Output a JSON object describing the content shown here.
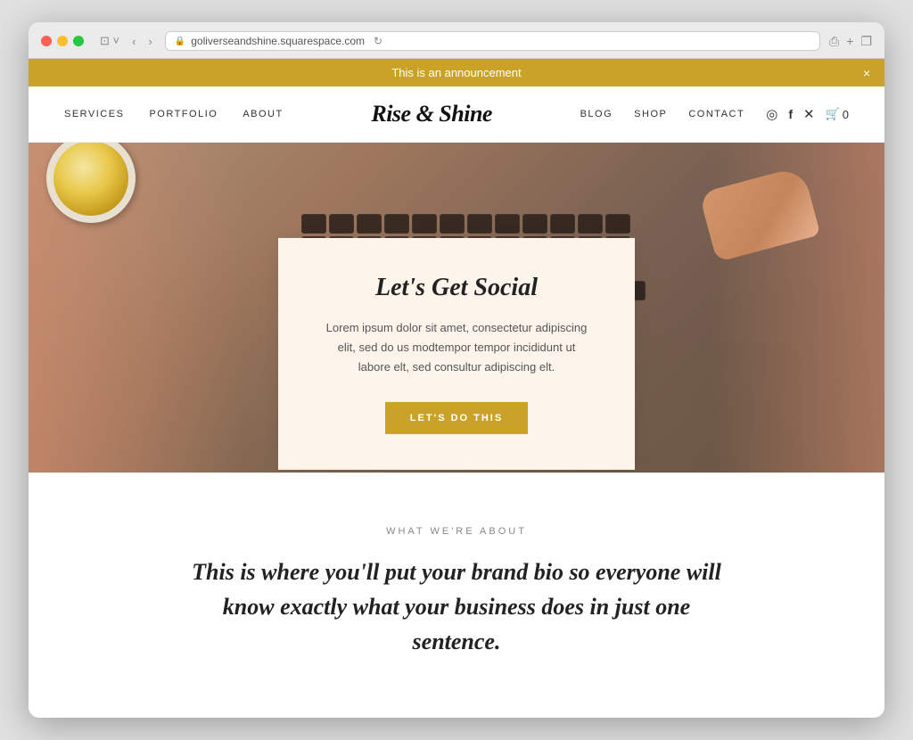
{
  "browser": {
    "url": "goliverseandshine.squarespace.com",
    "back_btn": "‹",
    "forward_btn": "›",
    "sidebar_btn": "⊡",
    "share_btn": "⎙",
    "new_tab_btn": "+",
    "windows_btn": "❐",
    "reload_btn": "↻"
  },
  "announcement": {
    "text": "This is an announcement",
    "close_label": "×"
  },
  "nav": {
    "logo": "Rise & Shine",
    "left_links": [
      "SERVICES",
      "PORTFOLIO",
      "ABOUT"
    ],
    "right_links": [
      "BLOG",
      "SHOP",
      "CONTACT"
    ],
    "cart_count": "0"
  },
  "hero": {
    "card": {
      "title": "Let's Get Social",
      "body": "Lorem ipsum dolor sit amet, consectetur adipiscing elit, sed do us modtempor tempor incididunt ut labore elt, sed consultur adipiscing elt.",
      "button_label": "LET'S DO THIS"
    }
  },
  "about": {
    "label": "WHAT WE'RE ABOUT",
    "title": "This is where you'll put your brand bio so everyone will know exactly what your business does in just one sentence."
  },
  "social_icons": {
    "instagram": "◎",
    "facebook": "f",
    "twitter": "𝕥",
    "cart": "🛒"
  }
}
